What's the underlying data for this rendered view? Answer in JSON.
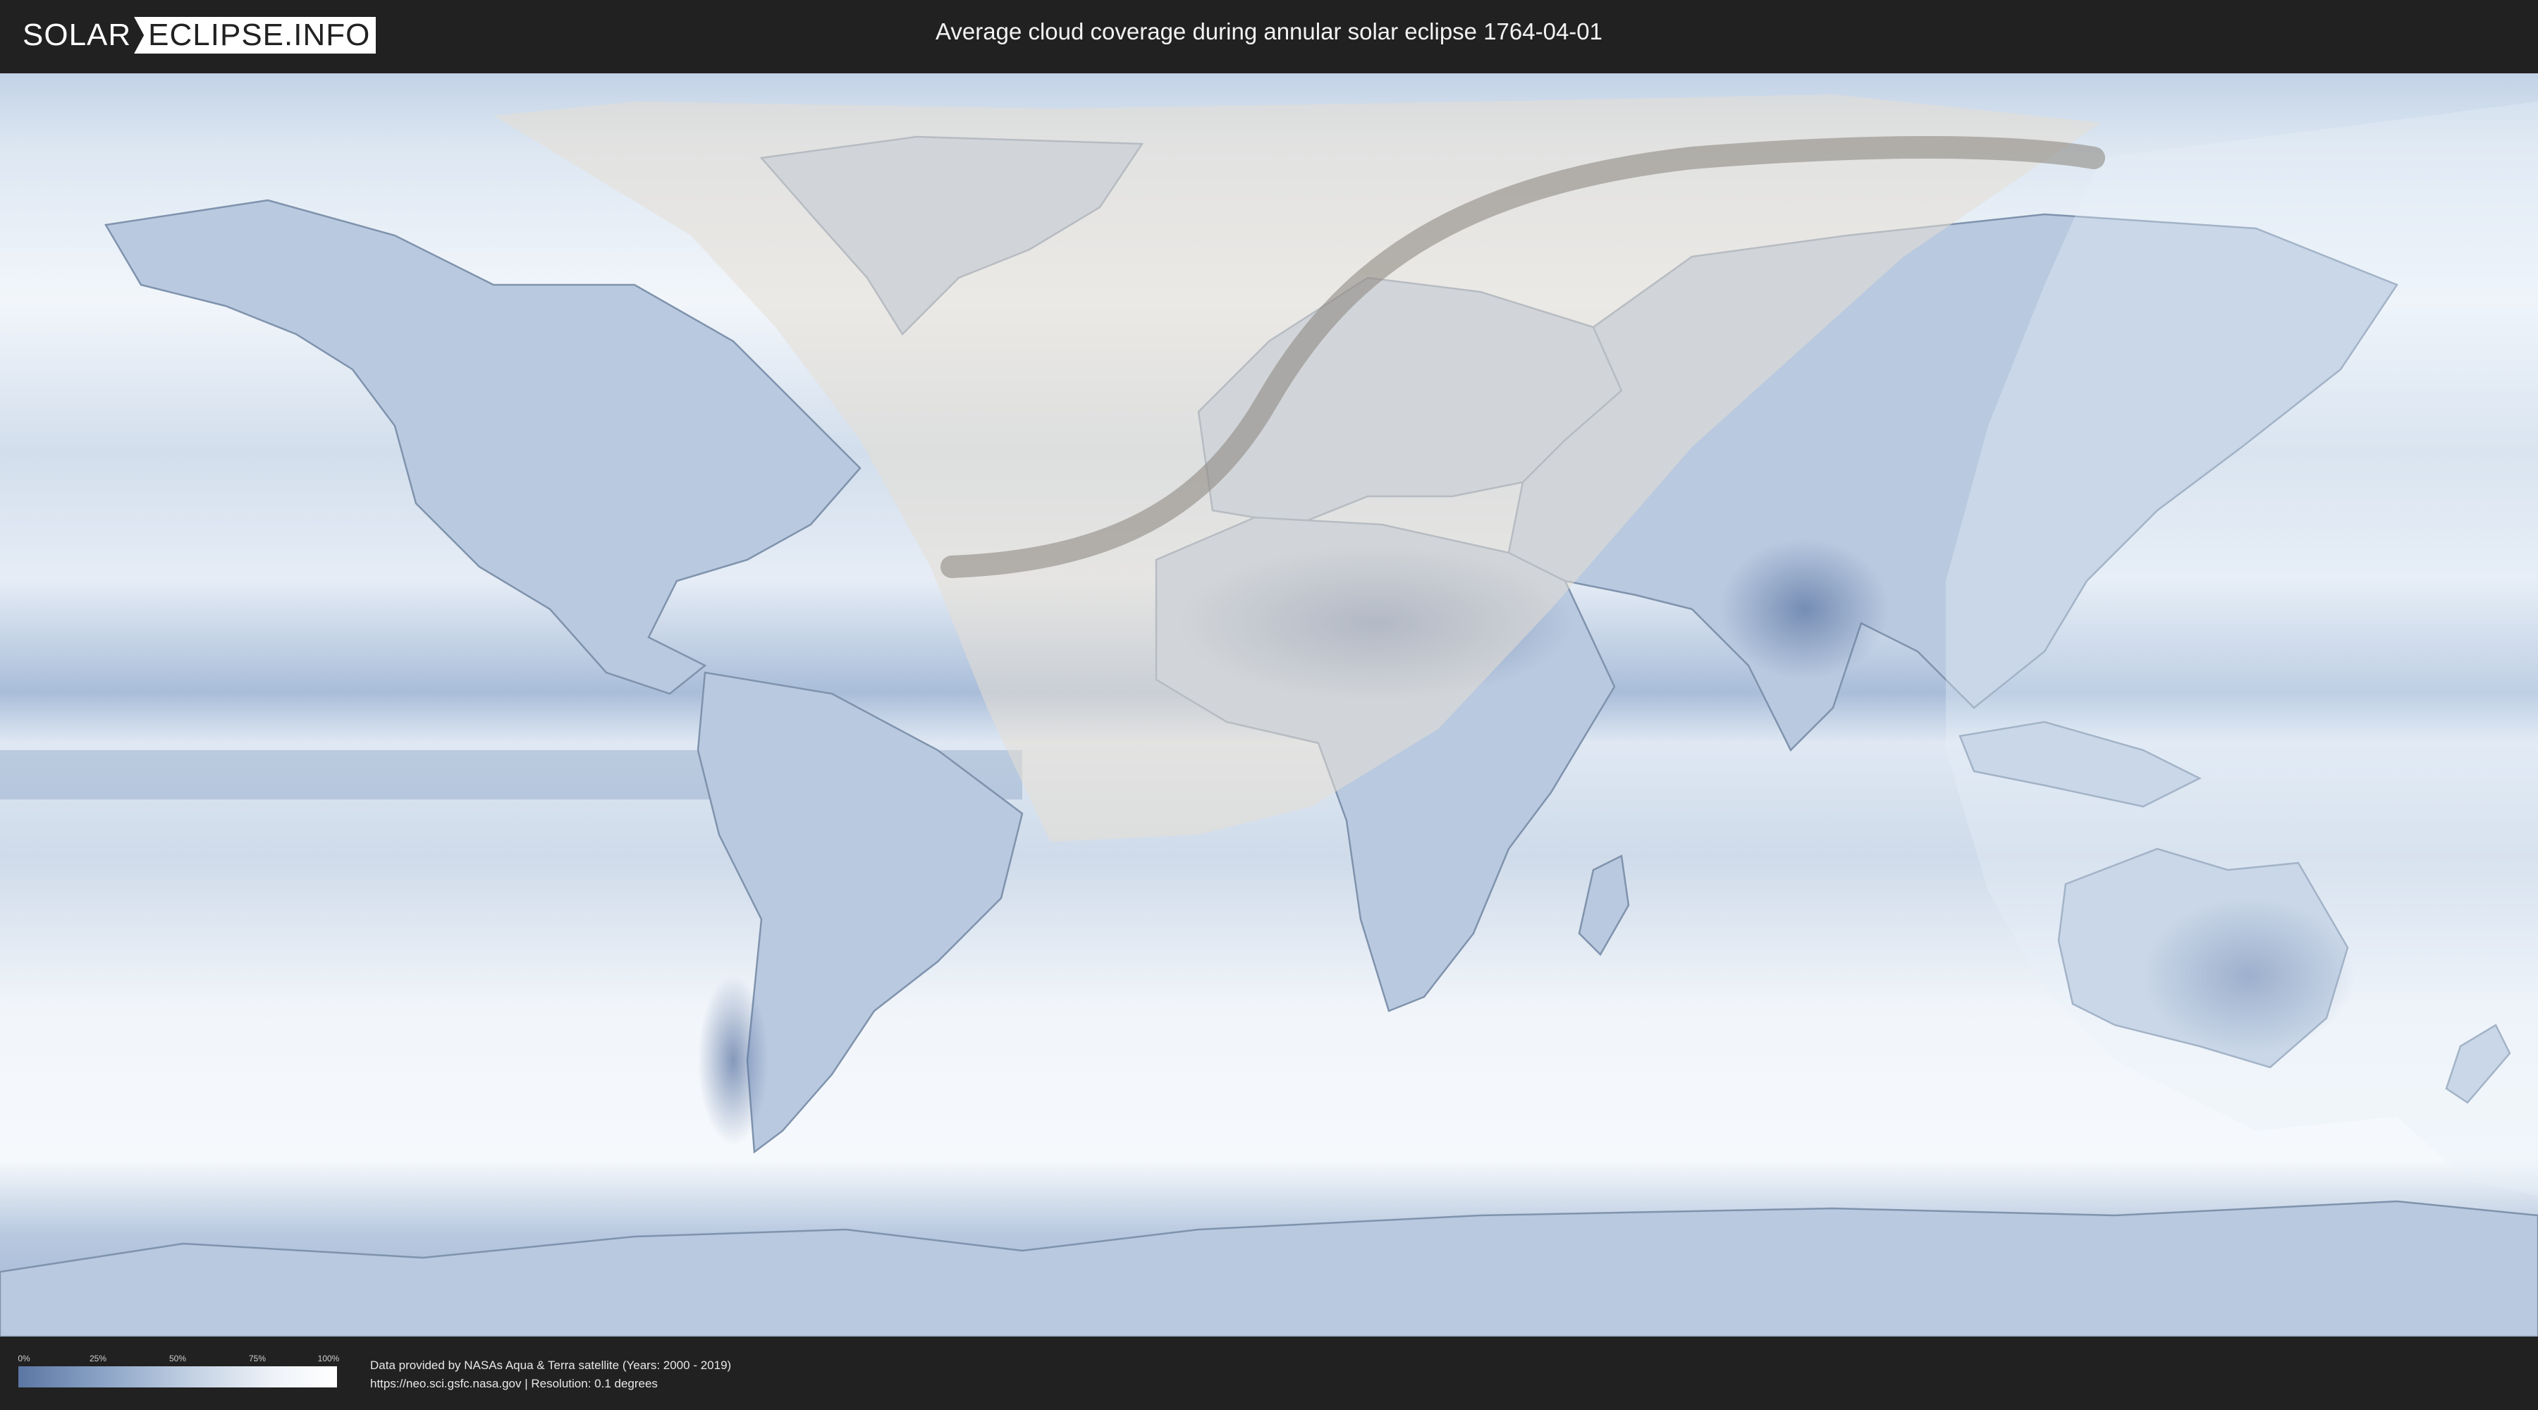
{
  "header": {
    "logo_left": "SOLAR",
    "logo_right": "ECLIPSE.INFO",
    "title": "Average cloud coverage during annular solar eclipse 1764-04-01"
  },
  "legend": {
    "ticks": [
      "0%",
      "25%",
      "50%",
      "75%",
      "100%"
    ],
    "gradient_colors": [
      "#5b76a3",
      "#8ea6c8",
      "#c4d2e4",
      "#eef2f8",
      "#ffffff"
    ]
  },
  "footer": {
    "credit_line": "Data provided by NASAs Aqua & Terra satellite (Years: 2000 - 2019)",
    "source_line": "https://neo.sci.gsfc.nasa.gov | Resolution: 0.1 degrees"
  },
  "map": {
    "projection": "equirectangular",
    "ocean_colors": [
      "#f4f7fb",
      "#c7d5e8",
      "#8fa7c9"
    ],
    "land_outline_color": "#7f93ad",
    "shadow_region_color": "#d9d2c8",
    "eclipse_path_color": "#8f8b84"
  }
}
